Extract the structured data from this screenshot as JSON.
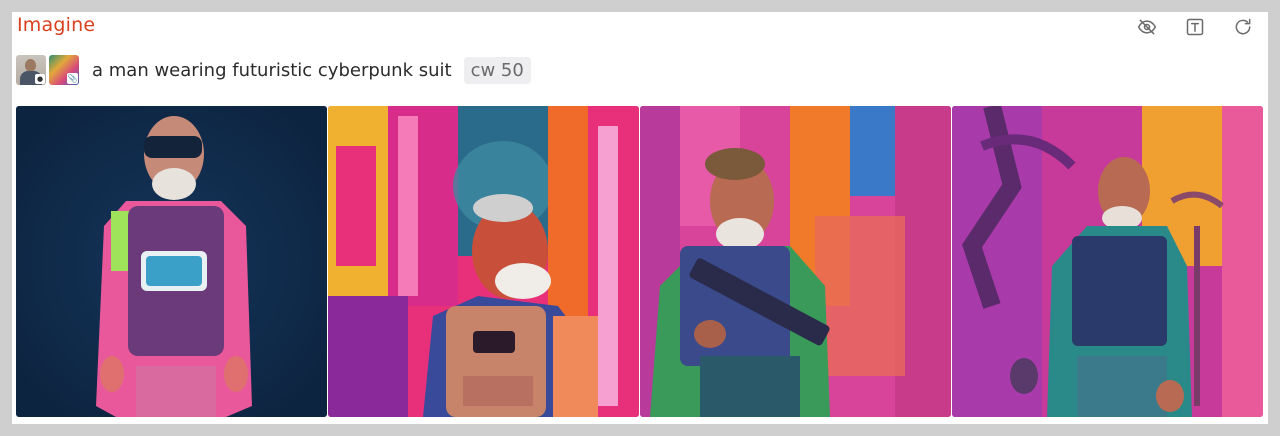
{
  "header": {
    "title": "Imagine"
  },
  "toolbar": {
    "buttons": [
      {
        "name": "hide-eye-icon"
      },
      {
        "name": "text-icon"
      },
      {
        "name": "refresh-icon"
      }
    ]
  },
  "prompt": {
    "reference_images": [
      {
        "name": "reference-photo-thumbnail",
        "badge_icon": "person-icon"
      },
      {
        "name": "reference-art-thumbnail",
        "badge_icon": "attachment-icon"
      }
    ],
    "text": "a man wearing futuristic cyberpunk suit",
    "cw_label": "cw 50"
  },
  "results": {
    "images": [
      {
        "name": "generated-image-1",
        "palette": [
          "#0f2a4a",
          "#e8589a",
          "#9fe35a"
        ]
      },
      {
        "name": "generated-image-2",
        "palette": [
          "#e8307a",
          "#2a6a8a",
          "#f0b030"
        ]
      },
      {
        "name": "generated-image-3",
        "palette": [
          "#d8449a",
          "#f07a2a",
          "#3a78c8"
        ]
      },
      {
        "name": "generated-image-4",
        "palette": [
          "#c83a9a",
          "#f0a030",
          "#2a9a8a"
        ]
      }
    ]
  },
  "colors": {
    "title_accent": "#d9401e",
    "frame_background": "#cfcfcf",
    "chip_background": "#eeeef0"
  }
}
